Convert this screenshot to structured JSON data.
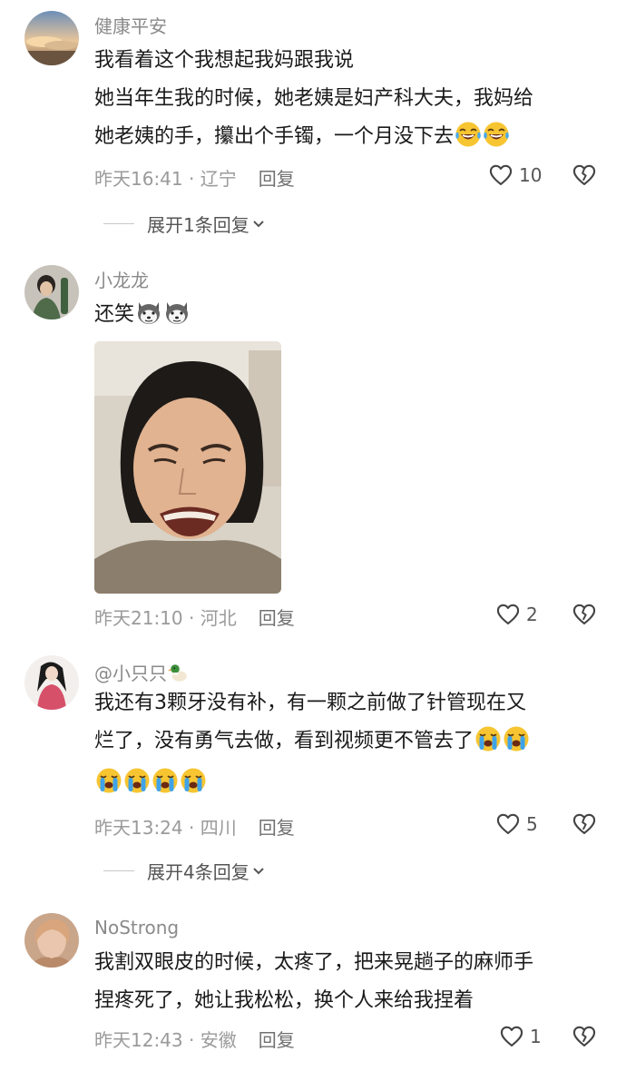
{
  "comments": [
    {
      "username": "健康平安",
      "lines": [
        "我看着这个我想起我妈跟我说",
        "她当年生我的时候，她老姨是妇产科大夫，我妈给",
        "她老姨的手，攥出个手镯，一个月没下去"
      ],
      "time_loc": "昨天16:41 · 辽宁",
      "reply_label": "回复",
      "likes": "10",
      "expand_label": "展开1条回复"
    },
    {
      "username": "小龙龙",
      "lines": [
        "还笑"
      ],
      "time_loc": "昨天21:10 · 河北",
      "reply_label": "回复",
      "likes": "2"
    },
    {
      "username": "@小只只",
      "lines": [
        "我还有3颗牙没有补，有一颗之前做了针管现在又",
        "烂了，没有勇气去做，看到视频更不管去了"
      ],
      "time_loc": "昨天13:24 · 四川",
      "reply_label": "回复",
      "likes": "5",
      "expand_label": "展开4条回复"
    },
    {
      "username": "NoStrong",
      "lines": [
        "我割双眼皮的时候，太疼了，把来晃趟子的麻师手",
        "捏疼死了，她让我松松，换个人来给我捏着"
      ],
      "time_loc": "昨天12:43 · 安徽",
      "reply_label": "回复",
      "likes": "1"
    }
  ],
  "icons": {
    "like": "heart-outline-icon",
    "dislike": "broken-heart-icon",
    "expand": "chevron-down-icon",
    "laugh_cry": "laughing-crying-emoji",
    "husky": "husky-dog-emoji",
    "crying": "loudly-crying-emoji",
    "duck": "duck-emoji"
  }
}
